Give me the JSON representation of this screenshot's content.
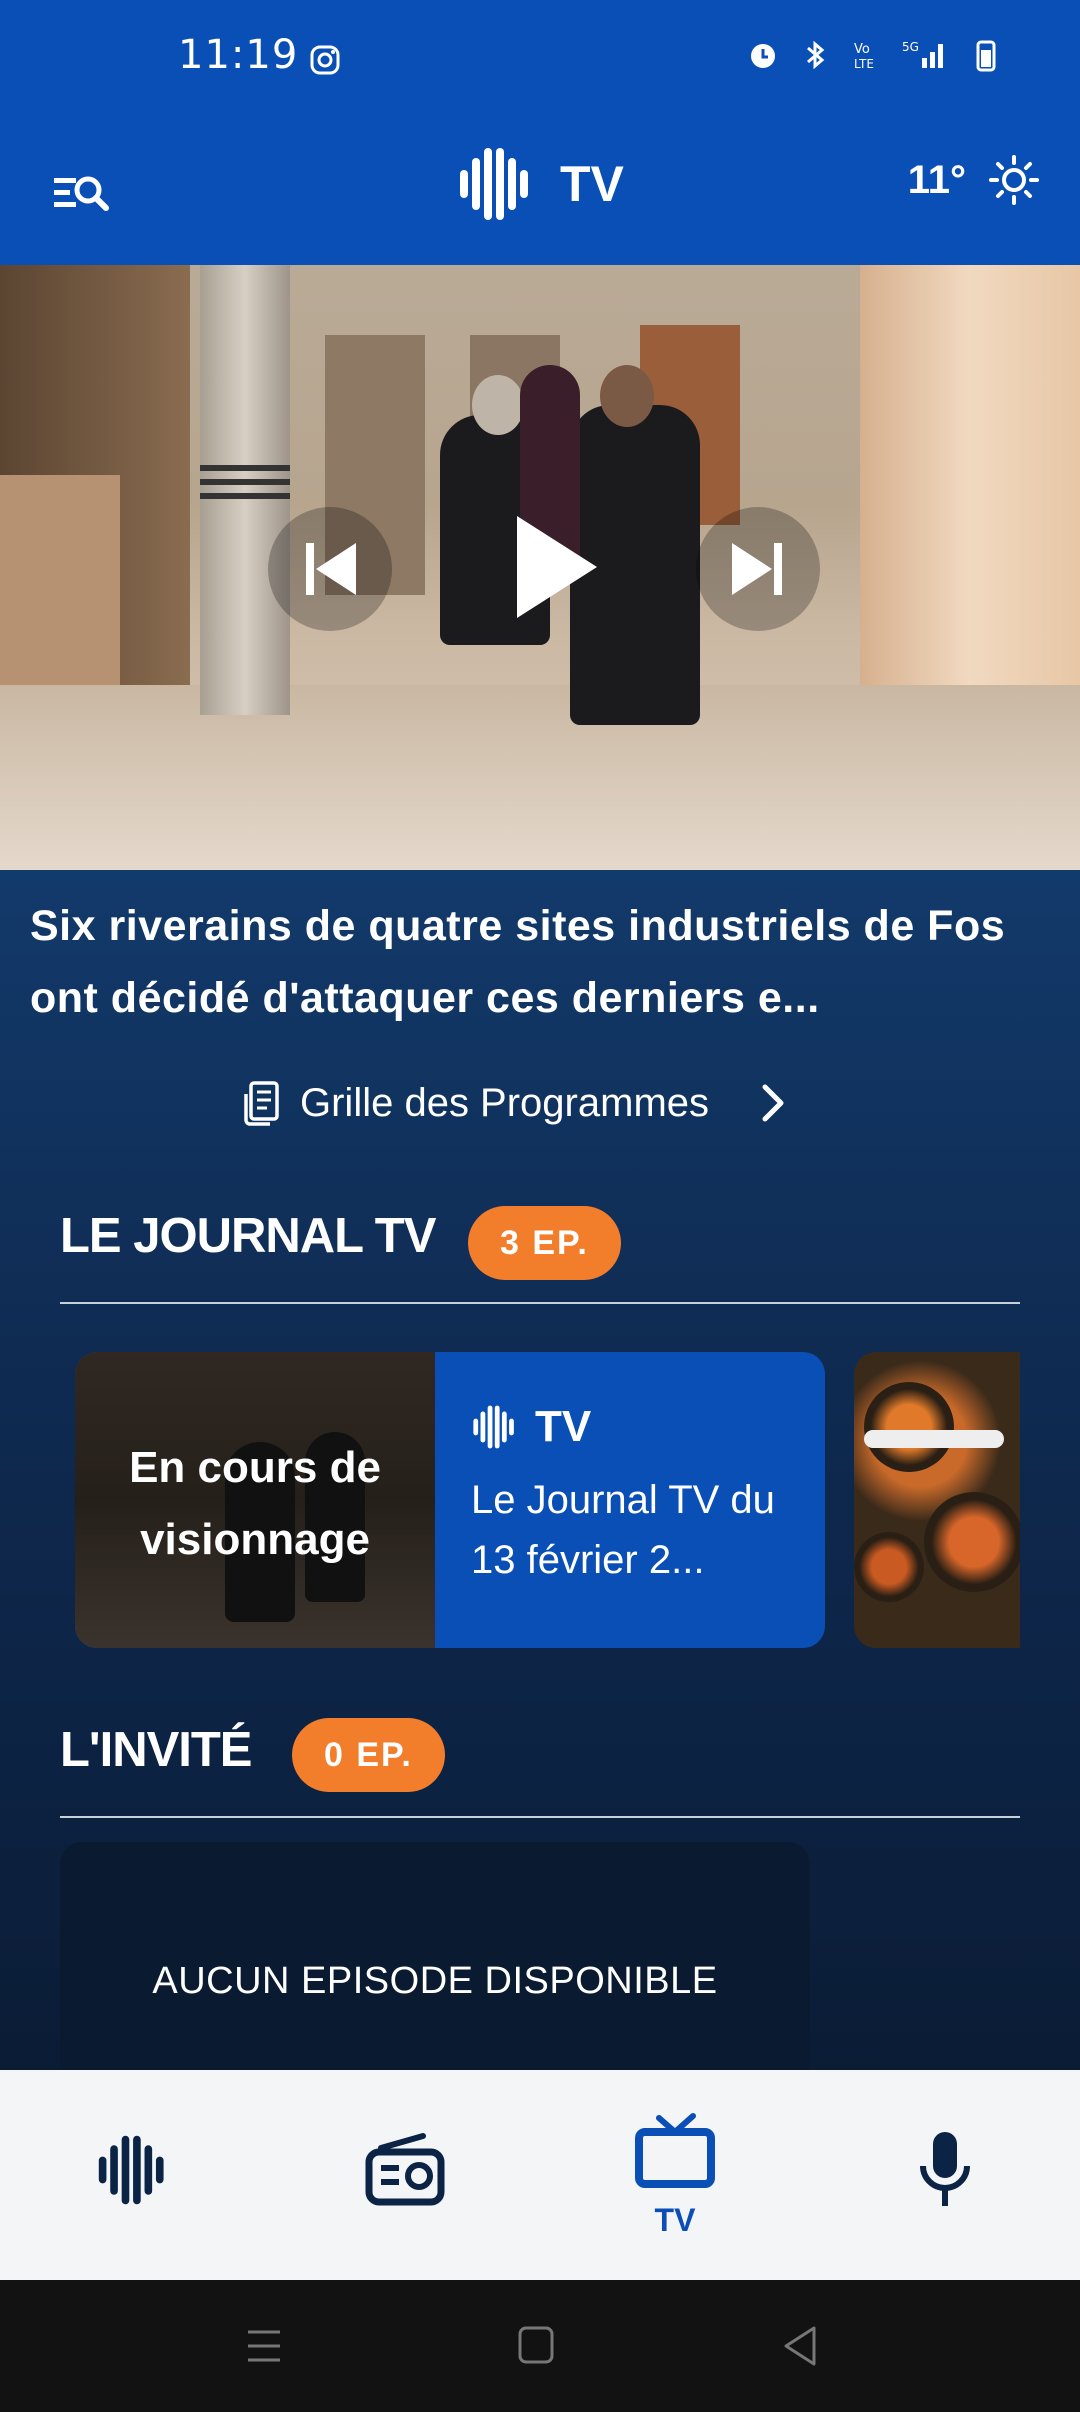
{
  "status_bar": {
    "time": "11:19"
  },
  "header": {
    "logo_text": "TV",
    "temperature": "11°"
  },
  "player": {
    "headline": "Six riverains de quatre sites industriels de Fos ont décidé d'attaquer ces derniers e..."
  },
  "grille": {
    "label": "Grille des Programmes"
  },
  "sections": [
    {
      "title": "LE JOURNAL TV",
      "badge": "3 EP.",
      "cards": [
        {
          "overlay": "En cours de visionnage",
          "logo_text": "TV",
          "title": "Le Journal TV du 13 février 2..."
        }
      ]
    },
    {
      "title": "L'INVITÉ",
      "badge": "0 EP.",
      "empty_text": "AUCUN EPISODE DISPONIBLE"
    }
  ],
  "bottom_nav": {
    "items": [
      {
        "label": ""
      },
      {
        "label": ""
      },
      {
        "label": "TV"
      },
      {
        "label": ""
      }
    ],
    "active_index": 2
  },
  "colors": {
    "brand_blue": "#0a4fb5",
    "badge_orange": "#f27d2a",
    "background": "#0b1b33"
  }
}
